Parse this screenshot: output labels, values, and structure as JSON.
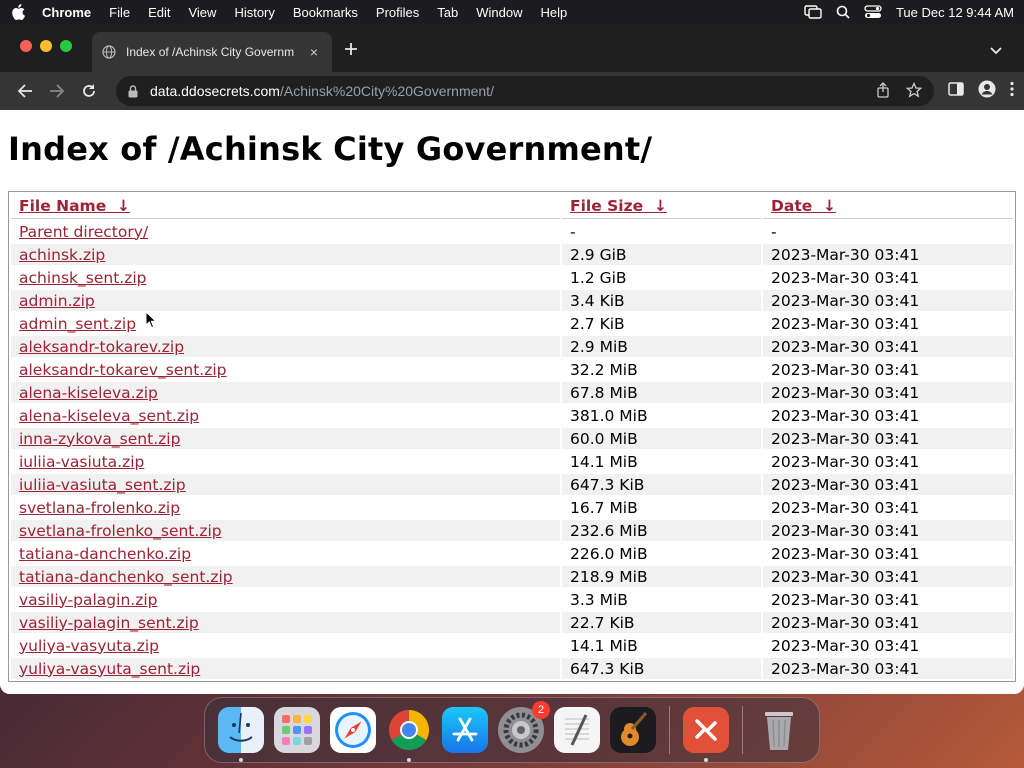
{
  "menubar": {
    "app_name": "Chrome",
    "items": [
      "File",
      "Edit",
      "View",
      "History",
      "Bookmarks",
      "Profiles",
      "Tab",
      "Window",
      "Help"
    ],
    "clock": "Tue Dec 12  9:44 AM"
  },
  "tab": {
    "title": "Index of /Achinsk City Governm",
    "close_label": "×"
  },
  "omnibox": {
    "host": "data.ddosecrets.com",
    "path": "/Achinsk%20City%20Government/"
  },
  "page": {
    "heading": "Index of /Achinsk City Government/",
    "columns": {
      "name": "File Name",
      "size": "File Size",
      "date": "Date",
      "sort_arrow": "↓"
    },
    "rows": [
      {
        "name": "Parent directory/",
        "size": "-",
        "date": "-"
      },
      {
        "name": "achinsk.zip",
        "size": "2.9 GiB",
        "date": "2023-Mar-30 03:41"
      },
      {
        "name": "achinsk_sent.zip",
        "size": "1.2 GiB",
        "date": "2023-Mar-30 03:41"
      },
      {
        "name": "admin.zip",
        "size": "3.4 KiB",
        "date": "2023-Mar-30 03:41"
      },
      {
        "name": "admin_sent.zip",
        "size": "2.7 KiB",
        "date": "2023-Mar-30 03:41"
      },
      {
        "name": "aleksandr-tokarev.zip",
        "size": "2.9 MiB",
        "date": "2023-Mar-30 03:41"
      },
      {
        "name": "aleksandr-tokarev_sent.zip",
        "size": "32.2 MiB",
        "date": "2023-Mar-30 03:41"
      },
      {
        "name": "alena-kiseleva.zip",
        "size": "67.8 MiB",
        "date": "2023-Mar-30 03:41"
      },
      {
        "name": "alena-kiseleva_sent.zip",
        "size": "381.0 MiB",
        "date": "2023-Mar-30 03:41"
      },
      {
        "name": "inna-zykova_sent.zip",
        "size": "60.0 MiB",
        "date": "2023-Mar-30 03:41"
      },
      {
        "name": "iuliia-vasiuta.zip",
        "size": "14.1 MiB",
        "date": "2023-Mar-30 03:41"
      },
      {
        "name": "iuliia-vasiuta_sent.zip",
        "size": "647.3 KiB",
        "date": "2023-Mar-30 03:41"
      },
      {
        "name": "svetlana-frolenko.zip",
        "size": "16.7 MiB",
        "date": "2023-Mar-30 03:41"
      },
      {
        "name": "svetlana-frolenko_sent.zip",
        "size": "232.6 MiB",
        "date": "2023-Mar-30 03:41"
      },
      {
        "name": "tatiana-danchenko.zip",
        "size": "226.0 MiB",
        "date": "2023-Mar-30 03:41"
      },
      {
        "name": "tatiana-danchenko_sent.zip",
        "size": "218.9 MiB",
        "date": "2023-Mar-30 03:41"
      },
      {
        "name": "vasiliy-palagin.zip",
        "size": "3.3 MiB",
        "date": "2023-Mar-30 03:41"
      },
      {
        "name": "vasiliy-palagin_sent.zip",
        "size": "22.7 KiB",
        "date": "2023-Mar-30 03:41"
      },
      {
        "name": "yuliya-vasyuta.zip",
        "size": "14.1 MiB",
        "date": "2023-Mar-30 03:41"
      },
      {
        "name": "yuliya-vasyuta_sent.zip",
        "size": "647.3 KiB",
        "date": "2023-Mar-30 03:41"
      }
    ]
  },
  "dock": {
    "apps": [
      "finder-icon",
      "launchpad-icon",
      "safari-icon",
      "chrome-icon",
      "app-store-icon",
      "system-settings-icon",
      "textedit-icon",
      "garageband-icon",
      "remote-desktop-icon",
      "trash-icon"
    ],
    "settings_badge": "2"
  },
  "colors": {
    "link": "#9b2335",
    "chrome_dark": "#353535",
    "menubar": "#1c1c1e"
  }
}
